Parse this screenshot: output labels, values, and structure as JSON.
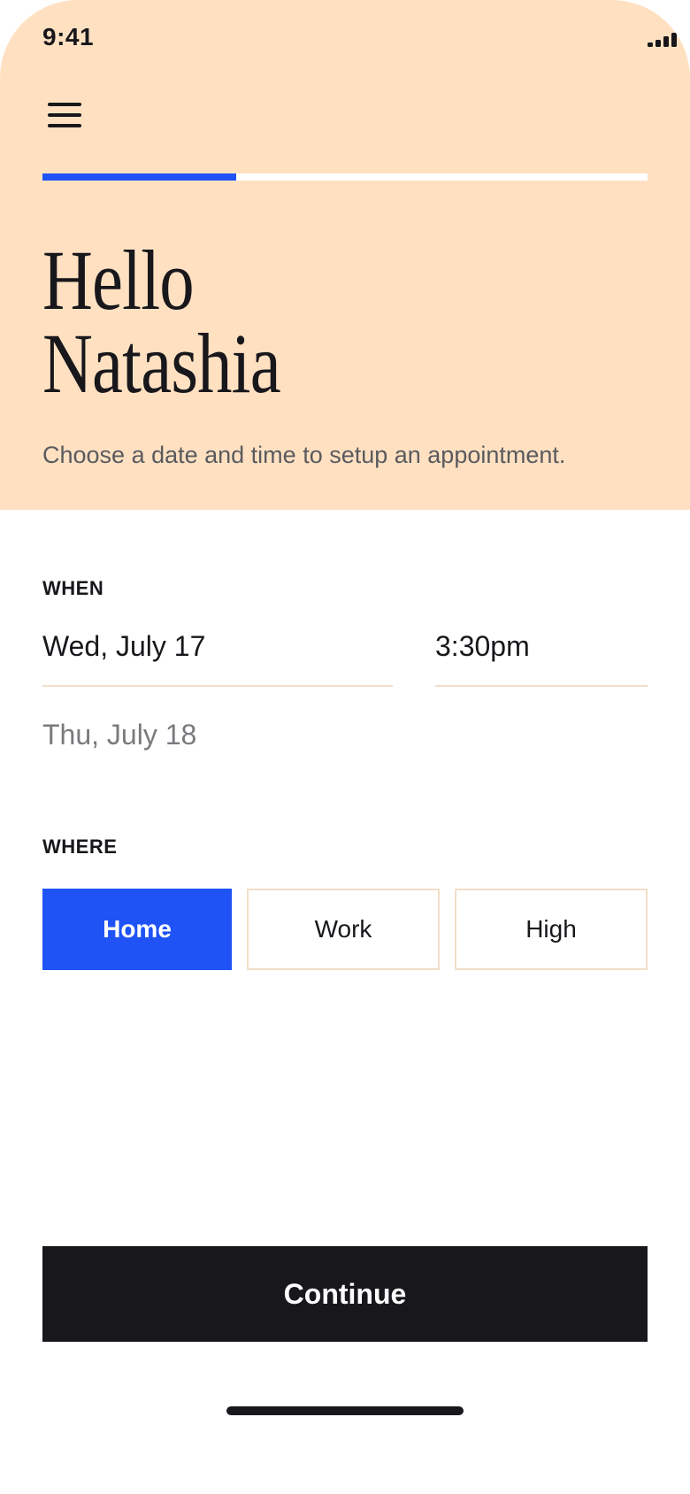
{
  "status_bar": {
    "time": "9:41",
    "icons": [
      "signal-icon",
      "wifi-icon",
      "battery-icon"
    ]
  },
  "header": {
    "menu_icon": "menu-icon",
    "progress_fraction": 0.32,
    "greeting_line1": "Hello",
    "greeting_line2": "Natashia",
    "subtitle": "Choose a date and time to setup an appointment."
  },
  "when": {
    "label": "WHEN",
    "selected_date": "Wed, July 17",
    "selected_time": "3:30pm",
    "next_date": "Thu, July 18"
  },
  "where": {
    "label": "WHERE",
    "options": [
      "Home",
      "Work",
      "High"
    ],
    "selected": "Home"
  },
  "footer": {
    "continue_label": "Continue"
  },
  "colors": {
    "hero_bg": "#FFE1C2",
    "accent": "#1F53F5",
    "dark": "#18171B",
    "divider": "#F2DFC9"
  }
}
